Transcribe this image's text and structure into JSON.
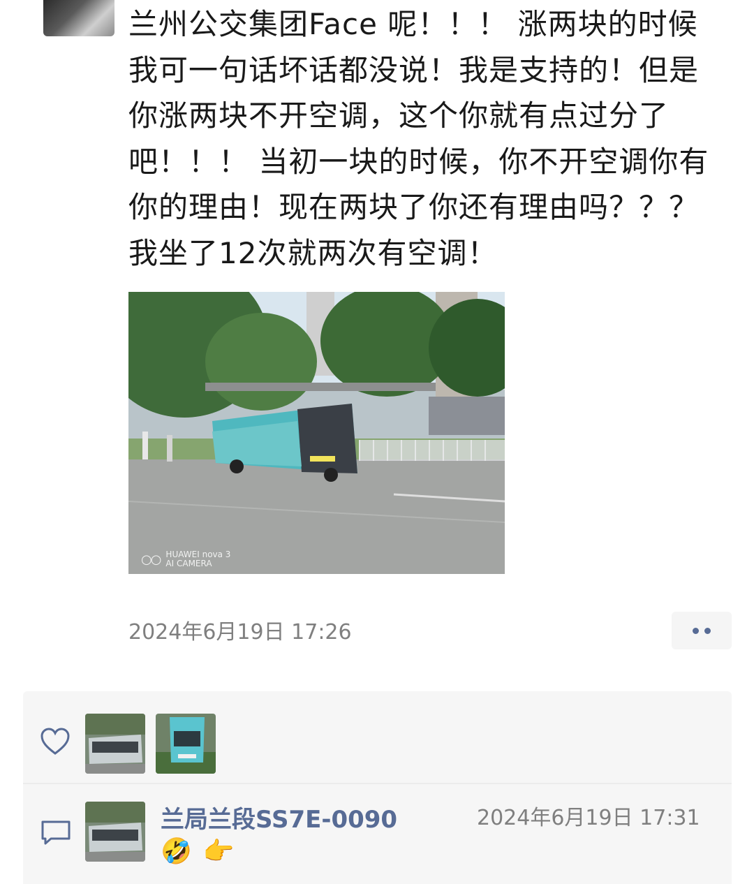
{
  "post": {
    "author_avatar_icon": "user-avatar-icon",
    "text": "兰州公交集团Face 呢！！！ 涨两块的时候我可一句话坏话都没说！我是支持的！但是你涨两块不开空调，这个你就有点过分了吧！！！ 当初一块的时候，你不开空调你有你的理由！现在两块了你还有理由吗？？？ 我坐了12次就两次有空调！",
    "photo_watermark_line1": "HUAWEI nova 3",
    "photo_watermark_line2": "AI CAMERA",
    "timestamp": "2024年6月19日 17:26",
    "more_button_icon": "more-dots-icon"
  },
  "likes": {
    "icon": "heart-icon",
    "avatars": [
      "bus-avatar-1",
      "bus-avatar-2"
    ]
  },
  "comment": {
    "icon": "comment-bubble-icon",
    "author": "兰局兰段SS7E-0090",
    "time": "2024年6月19日 17:31",
    "emojis": [
      "🤣",
      "👉"
    ]
  },
  "colors": {
    "link": "#576b95",
    "muted": "#7f7f7f",
    "panel": "#f6f6f6"
  }
}
